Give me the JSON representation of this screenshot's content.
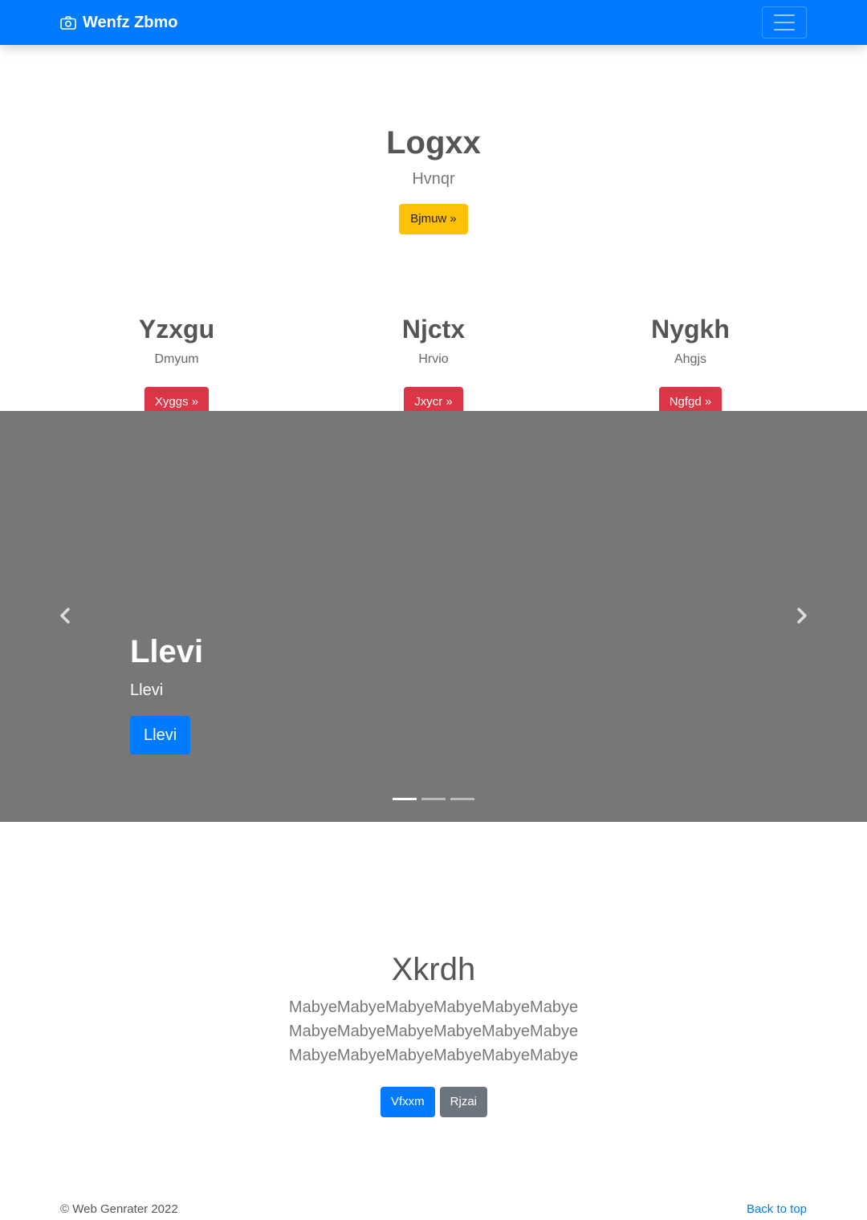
{
  "navbar": {
    "brand": "Wenfz Zbmo",
    "brand_icon": "camera-icon",
    "toggler_icon": "hamburger-icon",
    "bg_color": "#007bff"
  },
  "hero": {
    "title": "Logxx",
    "subtitle": "Hvnqr",
    "button": "Bjmuw »"
  },
  "features": [
    {
      "title": "Yzxgu",
      "text": "Dmyum",
      "button": "Xyggs »"
    },
    {
      "title": "Njctx",
      "text": "Hrvio",
      "button": "Jxycr »"
    },
    {
      "title": "Nygkh",
      "text": "Ahgjs",
      "button": "Ngfgd »"
    }
  ],
  "carousel": {
    "heading": "Llevi",
    "text": "Llevi",
    "button": "Llevi",
    "prev_icon": "chevron-left-icon",
    "next_icon": "chevron-right-icon",
    "slide_count": 3,
    "active_slide": 1
  },
  "jumbotron": {
    "title": "Xkrdh",
    "lines": [
      "MabyeMabyeMabyeMabyeMabyeMabye",
      "MabyeMabyeMabyeMabyeMabyeMabye",
      "MabyeMabyeMabyeMabyeMabyeMabye"
    ],
    "primary_button": "Vfxxm",
    "secondary_button": "Rjzai"
  },
  "footer": {
    "copyright": "© Web Genrater 2022",
    "back_to_top": "Back to top"
  }
}
